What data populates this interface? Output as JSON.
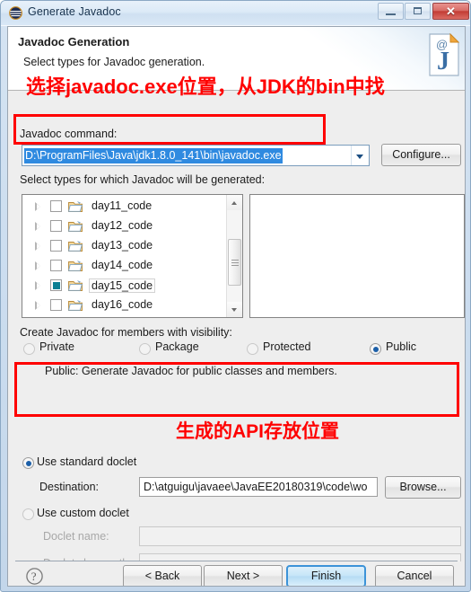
{
  "window": {
    "title": "Generate Javadoc",
    "icon": "javadoc-app-icon",
    "controls": {
      "minimize": "minimize-icon",
      "maximize": "maximize-icon",
      "close": "✕"
    }
  },
  "header": {
    "title": "Javadoc Generation",
    "subtitle": "Select types for Javadoc generation.",
    "icon": "javadoc-page-icon"
  },
  "javadoc_command": {
    "label": "Javadoc command:",
    "value": "D:\\ProgramFiles\\Java\\jdk1.8.0_141\\bin\\javadoc.exe",
    "selected": true,
    "selection_color": "#2f8ae0",
    "configure_label": "Configure..."
  },
  "types": {
    "label": "Select types for which Javadoc will be generated:",
    "tree": [
      {
        "label": "day11_code",
        "checked": false,
        "selected": false,
        "expandable": true
      },
      {
        "label": "day12_code",
        "checked": false,
        "selected": false,
        "expandable": true
      },
      {
        "label": "day13_code",
        "checked": false,
        "selected": false,
        "expandable": true
      },
      {
        "label": "day14_code",
        "checked": false,
        "selected": false,
        "expandable": true
      },
      {
        "label": "day15_code",
        "checked": true,
        "selected": true,
        "expandable": true
      },
      {
        "label": "day16_code",
        "checked": false,
        "selected": false,
        "expandable": true
      }
    ],
    "check_color": "#0b7f93",
    "right_panel_items": []
  },
  "visibility": {
    "label": "Create Javadoc for members with visibility:",
    "options": [
      {
        "label": "Private",
        "selected": false
      },
      {
        "label": "Package",
        "selected": false
      },
      {
        "label": "Protected",
        "selected": false
      },
      {
        "label": "Public",
        "selected": true
      }
    ],
    "description": "Public: Generate Javadoc for public classes and members."
  },
  "doclet": {
    "standard": {
      "label": "Use standard doclet",
      "selected": true,
      "destination_label": "Destination:",
      "destination_value": "D:\\atguigu\\javaee\\JavaEE20180319\\code\\wo",
      "browse_label": "Browse..."
    },
    "custom": {
      "label": "Use custom doclet",
      "selected": false,
      "name_label": "Doclet name:",
      "name_value": "",
      "classpath_label": "Doclet class path:",
      "classpath_value": "",
      "enabled": false
    }
  },
  "footer": {
    "help_icon": "help-question-icon",
    "back_label": "< Back",
    "next_label": "Next >",
    "finish_label": "Finish",
    "cancel_label": "Cancel",
    "default_button": "Finish"
  },
  "annotations": {
    "color": "#ff0000",
    "note1": "选择javadoc.exe位置，从JDK的bin中找",
    "note2": "生成的API存放位置"
  }
}
